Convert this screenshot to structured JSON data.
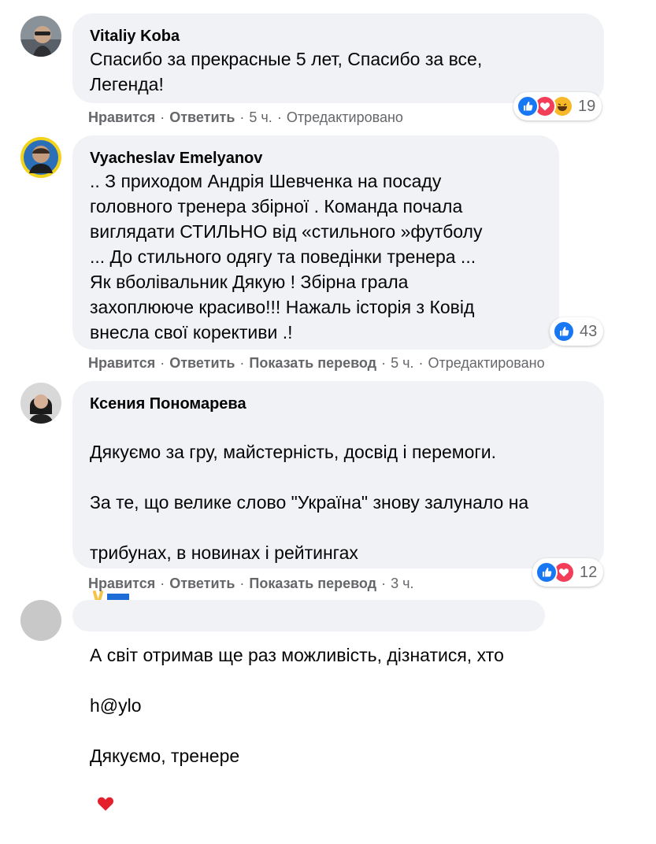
{
  "colors": {
    "bubble_bg": "#f0f2f5",
    "meta_text": "#65676b",
    "like_blue": "#1877f2",
    "love_red": "#f33e58",
    "haha_yellow": "#f7b928"
  },
  "comments": [
    {
      "author": "Vitaliy Koba",
      "text": "Спасибо за прекрасные 5 лет, Спасибо за все,\nЛегенда!",
      "actions": {
        "like": "Нравится",
        "reply": "Ответить",
        "time": "5 ч.",
        "edited": "Отредактировано"
      },
      "reactions": {
        "icons": [
          "like-icon",
          "love-icon",
          "haha-icon"
        ],
        "count": "19"
      }
    },
    {
      "author": "Vyacheslav Emelyanov",
      "text": ".. З приходом Андрія Шевченка на посаду\nголовного тренера збірної . Команда почала\nвиглядати СТИЛЬНО від «стильного »футболу\n... До стильного одягу та поведінки тренера ...\nЯк вболівальник Дякую ! Збірна грала\nзахоплююче красиво!!! Нажаль історія з Ковід\nвнесла свої корективи .!",
      "actions": {
        "like": "Нравится",
        "reply": "Ответить",
        "translate": "Показать перевод",
        "time": "5 ч.",
        "edited": "Отредактировано"
      },
      "reactions": {
        "icons": [
          "like-icon"
        ],
        "count": "43"
      }
    },
    {
      "author": "Ксения Пономарева",
      "text_lines": [
        "Дякуємо за гру, майстерність, досвід і перемоги.",
        "За те, що велике слово \"Україна\" знову залунало на",
        "трибунах, в новинах і рейтингах",
        "А світ отримав ще раз можливість, дізнатися, хто",
        "h@ylo",
        "Дякуємо, тренере"
      ],
      "emoji_line3": [
        "victory-hand-icon",
        "ukraine-flag-icon"
      ],
      "emoji_line6": [
        "red-heart-icon"
      ],
      "actions": {
        "like": "Нравится",
        "reply": "Ответить",
        "translate": "Показать перевод",
        "time": "3 ч."
      },
      "reactions": {
        "icons": [
          "like-icon",
          "love-icon"
        ],
        "count": "12"
      }
    }
  ]
}
